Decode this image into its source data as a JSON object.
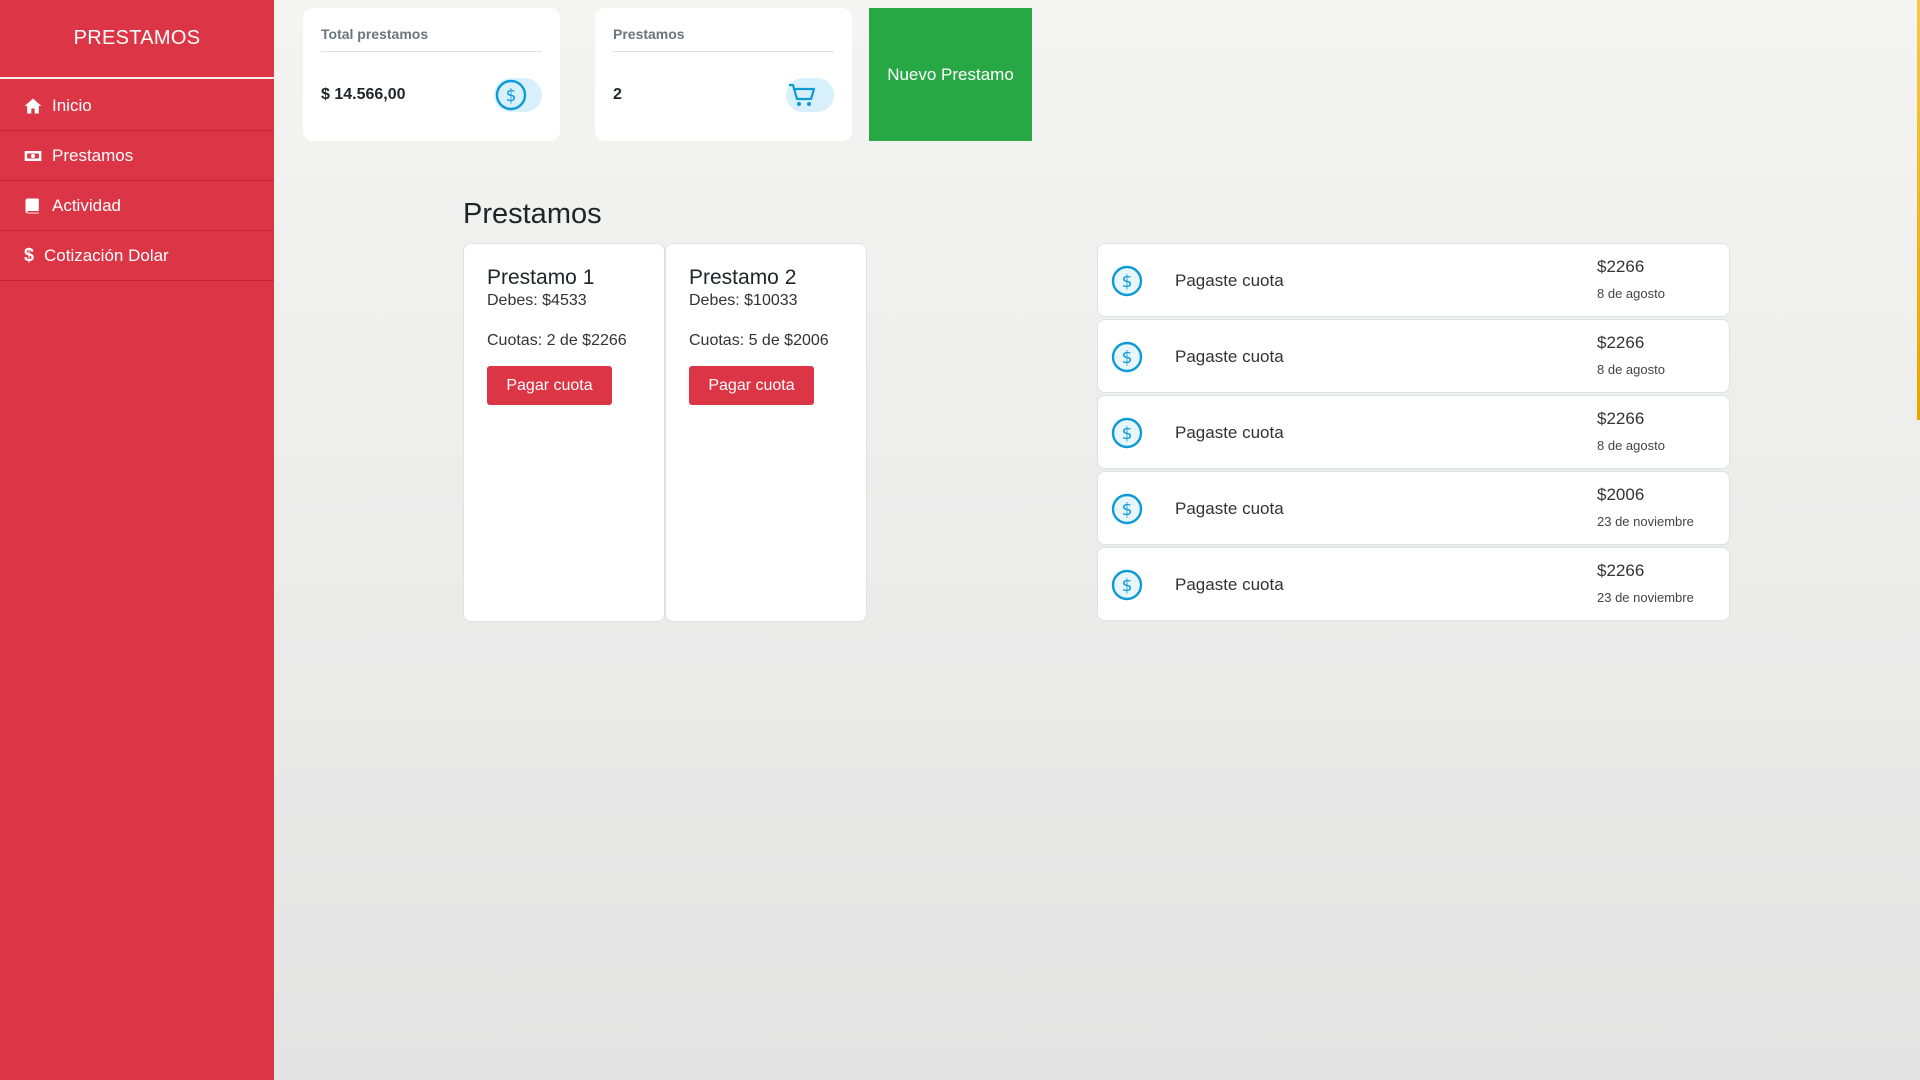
{
  "sidebar": {
    "brand": "PRESTAMOS",
    "items": [
      {
        "label": "Inicio",
        "icon": "home-icon"
      },
      {
        "label": "Prestamos",
        "icon": "money-bill-icon"
      },
      {
        "label": "Actividad",
        "icon": "book-icon"
      },
      {
        "label": "Cotización Dolar",
        "icon": "dollar-icon"
      }
    ]
  },
  "stats": {
    "total": {
      "title": "Total prestamos",
      "value": "$ 14.566,00",
      "icon": "dollar-circle-icon"
    },
    "count": {
      "title": "Prestamos",
      "value": "2",
      "icon": "cart-icon"
    }
  },
  "new_loan_button": "Nuevo Prestamo",
  "loans_section": {
    "title": "Prestamos",
    "loans": [
      {
        "name": "Prestamo 1",
        "debt": "Debes: $4533",
        "quotas": "Cuotas: 2 de $2266",
        "button": "Pagar cuota"
      },
      {
        "name": "Prestamo 2",
        "debt": "Debes: $10033",
        "quotas": "Cuotas: 5 de $2006",
        "button": "Pagar cuota"
      }
    ]
  },
  "activity": [
    {
      "label": "Pagaste cuota",
      "amount": "$2266",
      "date": "8 de agosto"
    },
    {
      "label": "Pagaste cuota",
      "amount": "$2266",
      "date": "8 de agosto"
    },
    {
      "label": "Pagaste cuota",
      "amount": "$2266",
      "date": "8 de agosto"
    },
    {
      "label": "Pagaste cuota",
      "amount": "$2006",
      "date": "23 de noviembre"
    },
    {
      "label": "Pagaste cuota",
      "amount": "$2266",
      "date": "23 de noviembre"
    }
  ],
  "colors": {
    "sidebar": "#dc3545",
    "primary_button": "#28a745",
    "danger_button": "#dc3545",
    "icon_blue": "#0d9bd8"
  }
}
